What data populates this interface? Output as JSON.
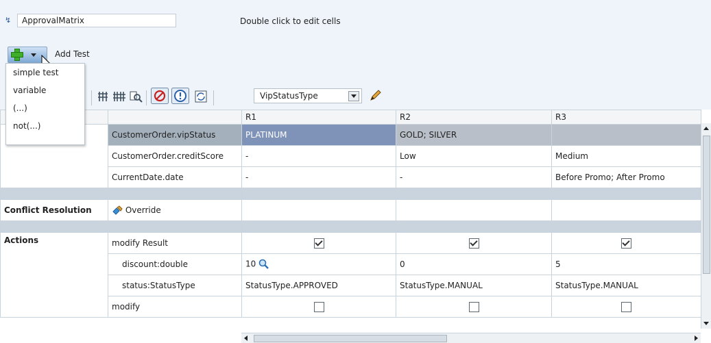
{
  "header": {
    "ruleset_name": "ApprovalMatrix",
    "hint": "Double click to edit cells",
    "add_label": "Add Test"
  },
  "add_menu": {
    "items": [
      "simple test",
      "variable",
      "(...)",
      "not(...)"
    ]
  },
  "toolbar": {
    "icons": [
      "add-column-icon",
      "add-row-icon",
      "find-icon",
      "conflict-stop-icon",
      "alert-icon",
      "refresh-icon"
    ],
    "bucketset_value": "VipStatusType",
    "edit_icon": "pencil-icon"
  },
  "grid": {
    "columns": [
      "R1",
      "R2",
      "R3"
    ],
    "conditions": [
      {
        "label": "CustomerOrder.vipStatus",
        "values": [
          "PLATINUM",
          "GOLD; SILVER",
          ""
        ]
      },
      {
        "label": "CustomerOrder.creditScore",
        "values": [
          "-",
          "Low",
          "Medium"
        ]
      },
      {
        "label": "CurrentDate.date",
        "values": [
          "-",
          "-",
          "Before Promo; After Promo"
        ]
      }
    ],
    "conflict_resolution": {
      "label": "Conflict Resolution",
      "value": "Override"
    },
    "actions": {
      "label": "Actions",
      "rows": [
        {
          "label": "modify Result",
          "checks": [
            true,
            true,
            true
          ]
        },
        {
          "label": "discount:double",
          "values": [
            "10",
            "0",
            "5"
          ]
        },
        {
          "label": "status:StatusType",
          "values": [
            "StatusType.APPROVED",
            "StatusType.MANUAL",
            "StatusType.MANUAL"
          ]
        },
        {
          "label": "modify",
          "checks": [
            false,
            false,
            false
          ]
        }
      ]
    }
  },
  "colors": {
    "selected_cell": "#7f93b8",
    "selected_row": "#b8bfc8",
    "header_bg": "#eef4fa"
  }
}
